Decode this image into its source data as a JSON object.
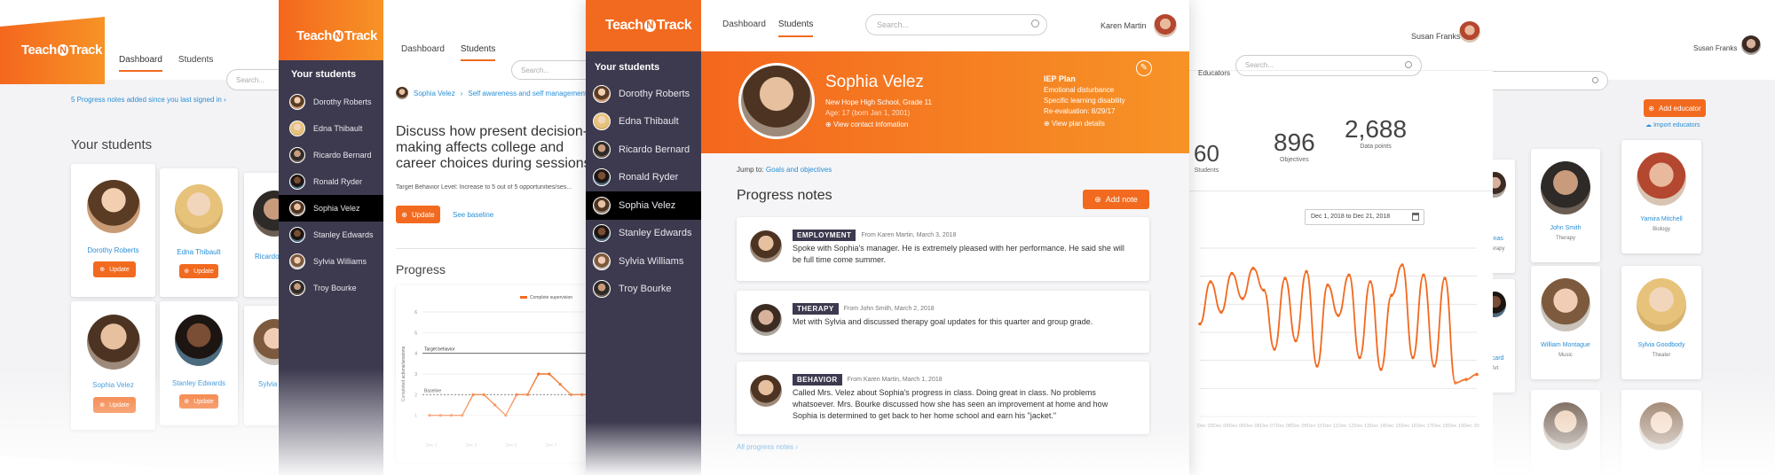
{
  "brand": {
    "logo_pre": "Teach",
    "logo_n": "N",
    "logo_post": "Track"
  },
  "colors": {
    "accent": "#f26a1f",
    "accent_light": "#f79326",
    "sidebar": "#3d3a4f",
    "link": "#2a8fd6"
  },
  "nav": {
    "dashboard": "Dashboard",
    "students": "Students"
  },
  "search": {
    "placeholder": "Search..."
  },
  "panel1": {
    "alert": "5 Progress notes added since you last signed in ›",
    "heading": "Your students",
    "cards": [
      {
        "name": "Dorothy Roberts",
        "button": "Update"
      },
      {
        "name": "Edna Thibault",
        "button": "Update"
      },
      {
        "name": "Ricardo",
        "button": "Update"
      },
      {
        "name": "Sophia Velez",
        "button": "Update"
      },
      {
        "name": "Stanley Edwards",
        "button": "Update"
      },
      {
        "name": "Sylvia",
        "button": "Update"
      }
    ]
  },
  "sidebar": {
    "title": "Your students",
    "items": [
      "Dorothy Roberts",
      "Edna Thibault",
      "Ricardo Bernard",
      "Ronald Ryder",
      "Sophia Velez",
      "Stanley Edwards",
      "Sylvia Williams",
      "Troy Bourke"
    ],
    "active_index": 4
  },
  "panel2": {
    "crumb_student": "Sophia Velez",
    "crumb_goal": "Self awareness and self management ›",
    "goal_title": "Discuss how present decision-making affects college and career choices during sessions",
    "target": "Target Behavior Level: Increase to 5 out of 5 opportunities/ses...",
    "update_button": "Update",
    "see_baseline": "See baseline",
    "progress_heading": "Progress",
    "legend": "Complete supervision",
    "target_label": "Target behavior",
    "baseline_label": "Baseline",
    "y_axis_label": "Completed actions/sessions",
    "chart_data": {
      "type": "line",
      "y_ticks": [
        1,
        2,
        3,
        4,
        5,
        6
      ],
      "x_ticks": [
        "Dec 1",
        "Dec 3",
        "Dec 5",
        "Dec 7",
        "Dec 9"
      ],
      "values": [
        1,
        1,
        1,
        1,
        2,
        2,
        1.5,
        1,
        2,
        2,
        3,
        3,
        2.5,
        2,
        2,
        2
      ],
      "target_y": 4,
      "baseline_y": 2,
      "ylim": [
        0,
        6
      ]
    }
  },
  "main": {
    "user": "Karen Martin",
    "student": {
      "name": "Sophia Velez",
      "school": "New Hope High School, Grade 11",
      "age": "Age: 17 (born Jan 1, 2001)",
      "contact_link": "View contact infomation"
    },
    "iep": {
      "title": "IEP Plan",
      "line1": "Emotional disturbance",
      "line2": "Specific learning disability",
      "line3": "Re-evaluation: 8/29/17",
      "link": "View plan details"
    },
    "jump_label": "Jump to:",
    "jump_link": "Goals and objectives",
    "notes_heading": "Progress notes",
    "add_note": "Add note",
    "notes": [
      {
        "tag": "EMPLOYMENT",
        "meta": "From Karen Martin, March 3, 2018",
        "text": "Spoke with Sophia's manager. He is extremely pleased with her performance. He said she will be full time come summer."
      },
      {
        "tag": "THERAPY",
        "meta": "From John Smith, March 2, 2018",
        "text": "Met with Sylvia and discussed therapy goal updates for this quarter and group grade."
      },
      {
        "tag": "BEHAVIOR",
        "meta": "From Karen Martin, March 1, 2018",
        "text": "Called Mrs. Velez about Sophia's progress in class. Doing great in class. No problems whatsoever. Mrs. Bourke discussed how she has seen an improvement at home and how Sophia is determined to get back to her home school and earn his \"jacket.\""
      }
    ],
    "all_notes": "All progress notes ›"
  },
  "panel4": {
    "user": "Susan Franks",
    "educators_tab": "Educators",
    "stats": [
      {
        "value": "60",
        "label": "Students"
      },
      {
        "value": "896",
        "label": "Objectives"
      },
      {
        "value": "2,688",
        "label": "Data points"
      }
    ],
    "date_range": "Dec 1, 2018 to Dec 21, 2018",
    "chart_data": {
      "type": "line",
      "x_ticks": [
        "Dec 03",
        "Dec 04",
        "Dec 05",
        "Dec 06",
        "Dec 07",
        "Dec 08",
        "Dec 09",
        "Dec 10",
        "Dec 11",
        "Dec 12",
        "Dec 13",
        "Dec 14",
        "Dec 15",
        "Dec 16",
        "Dec 17",
        "Dec 18",
        "Dec 19",
        "Dec 20"
      ],
      "values": [
        55,
        80,
        62,
        85,
        70,
        88,
        75,
        40,
        82,
        45,
        86,
        30,
        78,
        60,
        84,
        35,
        80,
        28,
        72,
        90,
        35,
        84,
        30,
        82,
        20,
        22,
        25
      ],
      "ylim": [
        0,
        100
      ]
    }
  },
  "panel5": {
    "user": "Susan Franks",
    "add_educator": "Add educator",
    "import_educators": "Import educators",
    "cards": [
      {
        "name": "Jonas",
        "role": "Therapy"
      },
      {
        "name": "John Smith",
        "role": "Therapy"
      },
      {
        "name": "Yamira Mitchell",
        "role": "Biology"
      },
      {
        "name": "Picard",
        "role": "Art"
      },
      {
        "name": "William Montague",
        "role": "Music"
      },
      {
        "name": "Sylvia Goodbody",
        "role": "Theater"
      }
    ]
  }
}
